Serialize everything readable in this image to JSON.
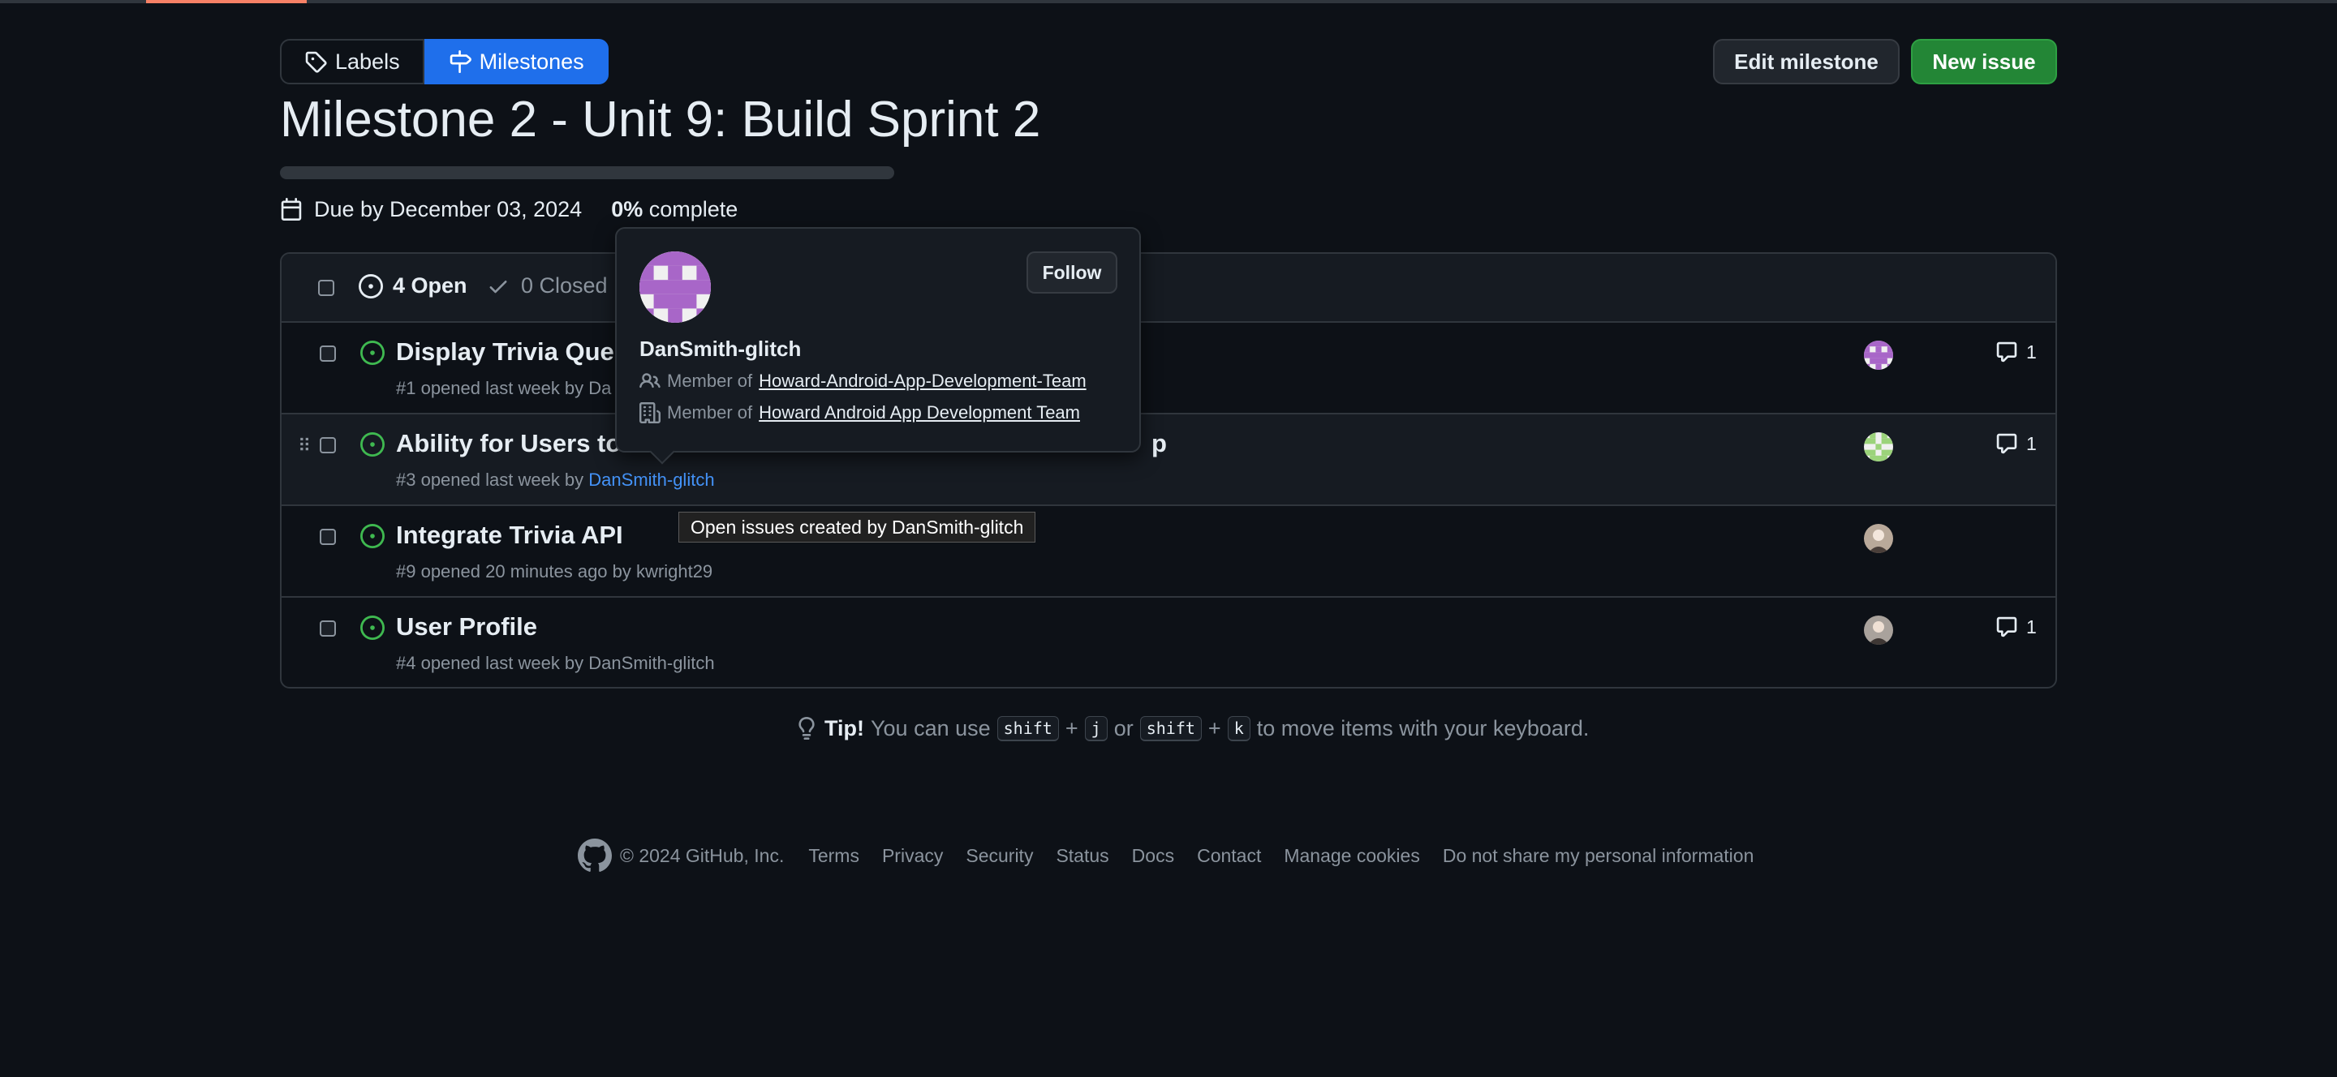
{
  "nav": {
    "labels_tab": "Labels",
    "milestones_tab": "Milestones"
  },
  "actions": {
    "edit_milestone": "Edit milestone",
    "new_issue": "New issue"
  },
  "milestone": {
    "title": "Milestone 2 - Unit 9: Build Sprint 2",
    "due": "Due by December 03, 2024",
    "percent": "0%",
    "complete_label": "complete",
    "progress_fraction": 0
  },
  "issues_header": {
    "open_count": "4 Open",
    "closed_count": "0 Closed"
  },
  "issues": [
    {
      "title": "Display Trivia Quest",
      "meta": "#1 opened last week by ",
      "author": "Da",
      "comments": "1",
      "avatar": "purple"
    },
    {
      "title": "Ability for Users to i",
      "title_tail": "p",
      "meta": "#3 opened last week by ",
      "author": "DanSmith-glitch",
      "comments": "1",
      "avatar": "green"
    },
    {
      "title": "Integrate Trivia API",
      "meta": "#9 opened 20 minutes ago by ",
      "author": "kwright29",
      "comments": "",
      "avatar": "person"
    },
    {
      "title": "User Profile",
      "meta": "#4 opened last week by ",
      "author": "DanSmith-glitch",
      "comments": "1",
      "avatar": "person2"
    }
  ],
  "hovercard": {
    "name": "DanSmith-glitch",
    "follow": "Follow",
    "member_of_1": "Member of ",
    "org_1": "Howard-Android-App-Development-Team",
    "member_of_2": "Member of ",
    "org_2": "Howard Android App Development Team"
  },
  "tooltip": "Open issues created by DanSmith-glitch",
  "tip": {
    "bold": "Tip!",
    "text1": "You can use",
    "key_shift": "shift",
    "plus": "+",
    "key_j": "j",
    "or": "or",
    "key_k": "k",
    "text2": "to move items with your keyboard."
  },
  "footer": {
    "copyright": "© 2024 GitHub, Inc.",
    "links": [
      "Terms",
      "Privacy",
      "Security",
      "Status",
      "Docs",
      "Contact",
      "Manage cookies",
      "Do not share my personal information"
    ]
  },
  "colors": {
    "accent": "#1f6feb",
    "success": "#238636",
    "open_icon": "#3fb950",
    "link": "#4493f8"
  }
}
